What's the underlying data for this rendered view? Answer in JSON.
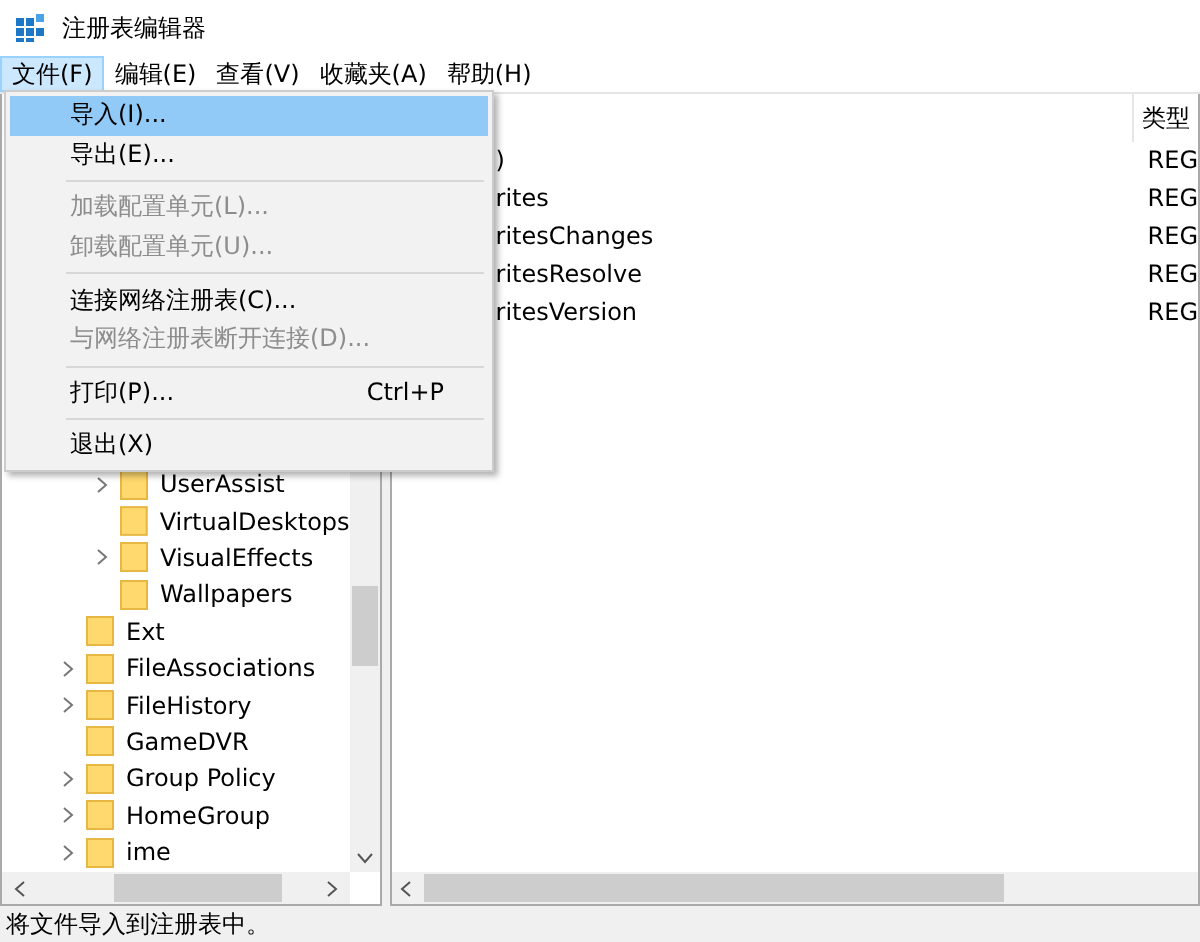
{
  "window": {
    "title": "注册表编辑器"
  },
  "menu_bar": [
    {
      "label": "文件(F)",
      "selected": true
    },
    {
      "label": "编辑(E)",
      "selected": false
    },
    {
      "label": "查看(V)",
      "selected": false
    },
    {
      "label": "收藏夹(A)",
      "selected": false
    },
    {
      "label": "帮助(H)",
      "selected": false
    }
  ],
  "file_menu": [
    {
      "kind": "item",
      "label": "导入(I)...",
      "selected": true,
      "disabled": false
    },
    {
      "kind": "item",
      "label": "导出(E)...",
      "selected": false,
      "disabled": false
    },
    {
      "kind": "separator"
    },
    {
      "kind": "item",
      "label": "加载配置单元(L)...",
      "selected": false,
      "disabled": true
    },
    {
      "kind": "item",
      "label": "卸载配置单元(U)...",
      "selected": false,
      "disabled": true
    },
    {
      "kind": "separator"
    },
    {
      "kind": "item",
      "label": "连接网络注册表(C)...",
      "selected": false,
      "disabled": false
    },
    {
      "kind": "item",
      "label": "与网络注册表断开连接(D)...",
      "selected": false,
      "disabled": true
    },
    {
      "kind": "separator"
    },
    {
      "kind": "item",
      "label": "打印(P)...",
      "shortcut": "Ctrl+P",
      "selected": false,
      "disabled": false
    },
    {
      "kind": "separator"
    },
    {
      "kind": "item",
      "label": "退出(X)",
      "selected": false,
      "disabled": false
    }
  ],
  "tree": {
    "items": [
      {
        "children": [
          {
            "label": "UserAssist",
            "has_children": true
          },
          {
            "label": "VirtualDesktops",
            "has_children": false
          },
          {
            "label": "VisualEffects",
            "has_children": true
          },
          {
            "label": "Wallpapers",
            "has_children": false
          }
        ]
      },
      {
        "label": "Ext",
        "has_children": false
      },
      {
        "label": "FileAssociations",
        "has_children": true
      },
      {
        "label": "FileHistory",
        "has_children": true
      },
      {
        "label": "GameDVR",
        "has_children": false
      },
      {
        "label": "Group Policy",
        "has_children": true
      },
      {
        "label": "HomeGroup",
        "has_children": true
      },
      {
        "label": "ime",
        "has_children": true
      }
    ]
  },
  "values": {
    "columns": [
      "类型"
    ],
    "rows": [
      {
        "name": ")",
        "type": "REG"
      },
      {
        "name": "rites",
        "type": "REG"
      },
      {
        "name": "ritesChanges",
        "type": "REG"
      },
      {
        "name": "ritesResolve",
        "type": "REG"
      },
      {
        "name": "ritesVersion",
        "type": "REG"
      }
    ]
  },
  "status_bar": "将文件导入到注册表中。"
}
